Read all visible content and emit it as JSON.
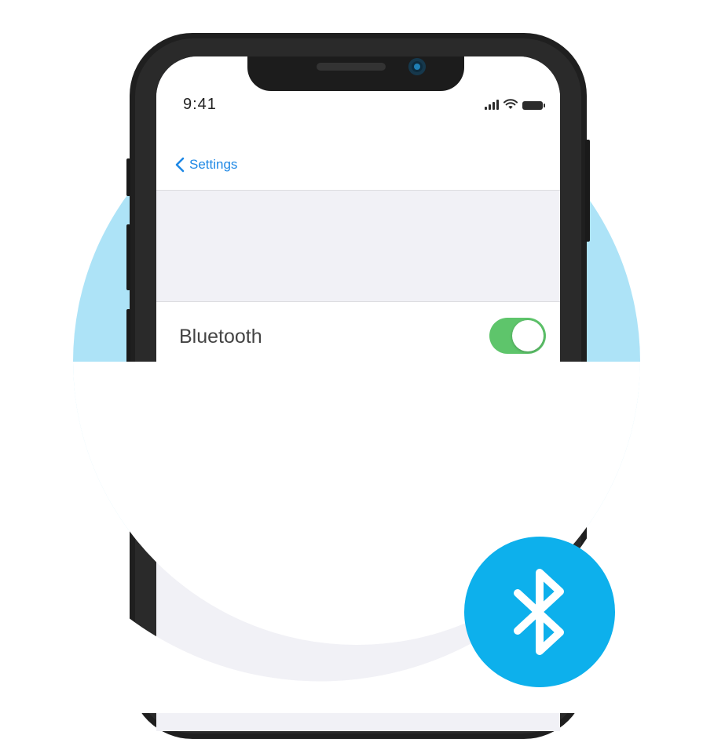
{
  "status_bar": {
    "time": "9:41"
  },
  "navbar": {
    "back_label": "Settings"
  },
  "settings_row": {
    "label": "Bluetooth",
    "toggle_on": true
  },
  "colors": {
    "accent": "#1e88e5",
    "toggle_on": "#5ec56b",
    "circle_bg": "#ade3f7",
    "badge": "#0db0ec"
  },
  "icons": {
    "back": "chevron-left-icon",
    "badge": "bluetooth-icon"
  }
}
